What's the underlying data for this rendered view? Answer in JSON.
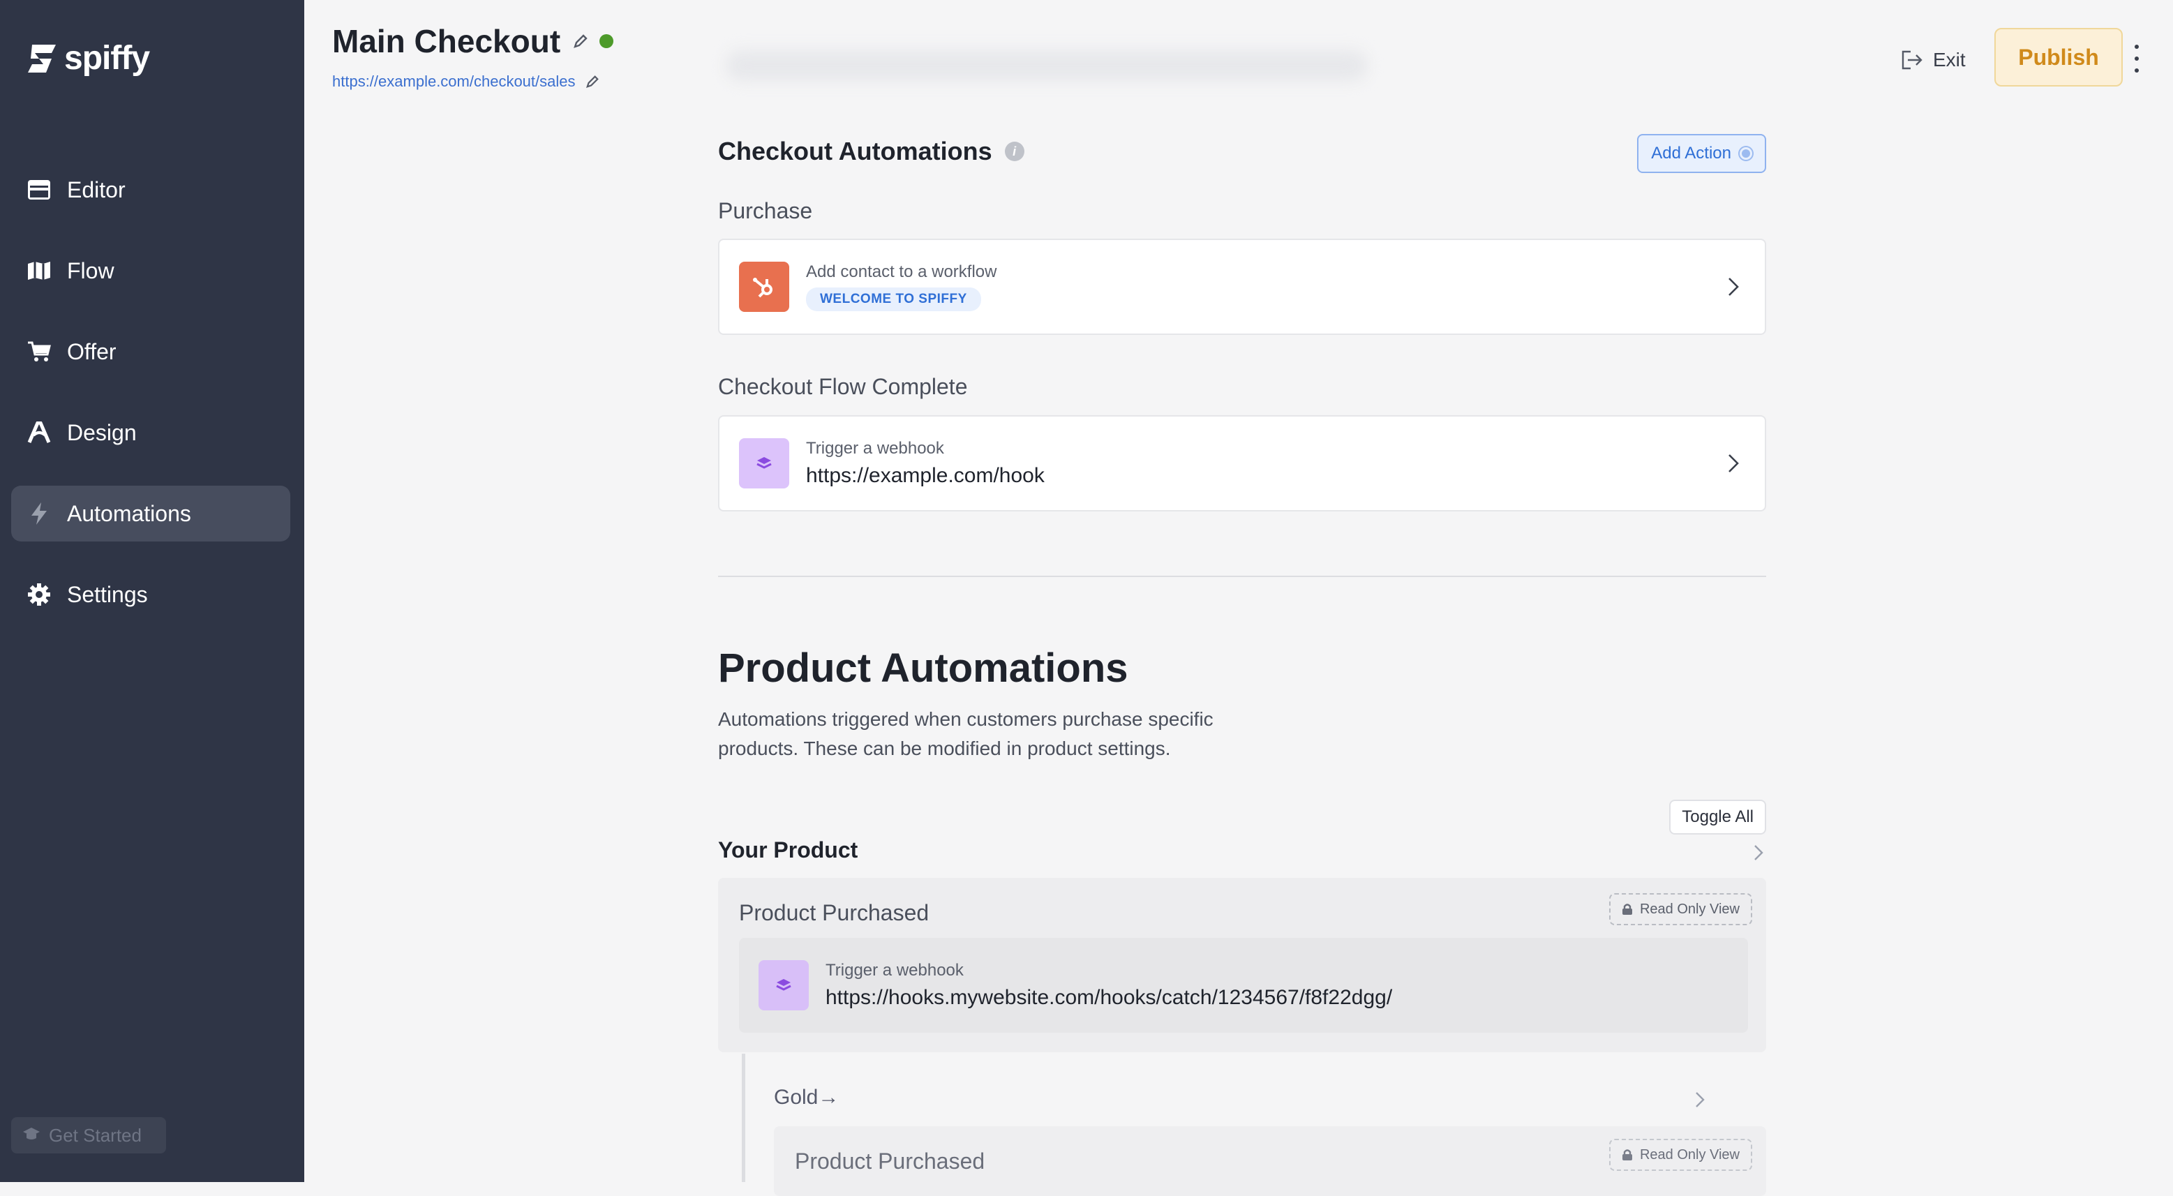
{
  "sidebar": {
    "logo": "spiffy",
    "items": [
      {
        "label": "Editor",
        "icon": "browser-window-icon"
      },
      {
        "label": "Flow",
        "icon": "map-icon"
      },
      {
        "label": "Offer",
        "icon": "cart-icon"
      },
      {
        "label": "Design",
        "icon": "design-a-icon"
      },
      {
        "label": "Automations",
        "icon": "lightning-icon",
        "active": true
      },
      {
        "label": "Settings",
        "icon": "gear-icon"
      }
    ],
    "get_started": "Get Started"
  },
  "header": {
    "title": "Main Checkout",
    "url": "https://example.com/checkout/sales",
    "exit_label": "Exit",
    "publish_label": "Publish"
  },
  "checkout": {
    "title": "Checkout Automations",
    "add_action": "Add Action",
    "groups": [
      {
        "name": "Purchase",
        "label": "Add contact to a workflow",
        "badge": "WELCOME TO SPIFFY"
      },
      {
        "name": "Checkout Flow Complete",
        "label": "Trigger a webhook",
        "value": "https://example.com/hook"
      }
    ]
  },
  "product": {
    "title": "Product Automations",
    "description": "Automations triggered when customers purchase specific products. These can be modified in product settings.",
    "toggle_all": "Toggle All",
    "product_name": "Your Product",
    "event": "Product Purchased",
    "read_only": "Read Only View",
    "action_label": "Trigger a webhook",
    "action_value": "https://hooks.mywebsite.com/hooks/catch/1234567/f8f22dgg/",
    "variant_name": "Gold→",
    "variant_event": "Product Purchased",
    "variant_read_only": "Read Only View"
  },
  "colors": {
    "sidebar_bg": "#2f3546",
    "accent_blue": "#2f6fd6",
    "publish_text": "#d08a1b",
    "status_green": "#4d9a2a",
    "hubspot_orange": "#e8704f",
    "webhook_purple": "#dcc3fb"
  }
}
